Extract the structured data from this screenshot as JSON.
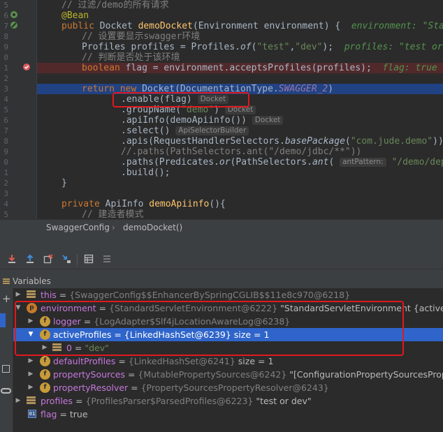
{
  "editor": {
    "line_numbers": [
      "5",
      "6",
      "7",
      "8",
      "9",
      "0",
      "1",
      "2",
      "3",
      "4",
      "5",
      "6",
      "7",
      "8",
      "9",
      "0",
      "1",
      "2",
      "3",
      "4",
      "5"
    ],
    "lines": {
      "l1_comment": "// 过滤/demo的所有请求",
      "l2_annotation": "@Bean",
      "l3_kw1": "public",
      "l3_type": " Docket ",
      "l3_method": "demoDocket",
      "l3_rest": "(Environment environment) {  ",
      "l3_inlay": "environment: \"StandardServ",
      "l4_comment": "// 设置要显示swagger环境",
      "l5_pre": "Profiles profiles = Profiles.",
      "l5_of": "of",
      "l5_args_open": "(",
      "l5_str1": "\"test\"",
      "l5_comma": ",",
      "l5_str2": "\"dev\"",
      "l5_close": ");  ",
      "l5_inlay": "profiles: \"test or dev\"",
      "l6_comment": "// 判断是否处于该环境",
      "l7_kw": "boolean",
      "l7_rest": " flag = environment.acceptsProfiles(profiles);  ",
      "l7_inlay": "flag: true  environ",
      "l9_kw1": "return",
      "l9_kw2": " new",
      "l9_rest": " Docket(DocumentationType.",
      "l9_const": "SWAGGER_2",
      "l9_close": ")",
      "l10_code": ".enable(flag)",
      "l10_hint": "Docket",
      "l11_code": ".groupName(",
      "l11_str": "\"demo\"",
      "l11_close": ")",
      "l11_hint": "Docket",
      "l12_code": ".apiInfo(demoApiinfo())",
      "l12_hint": "Docket",
      "l13_code": ".select()",
      "l13_hint": "ApiSelectorBuilder",
      "l14_code": ".apis(RequestHandlerSelectors.",
      "l14_method": "basePackage",
      "l14_open": "(",
      "l14_str": "\"com.jude.demo\"",
      "l14_close": "))",
      "l14_comment": "//",
      "l15_comment": "//.paths(PathSelectors.ant(\"/demo/jdbc/**\"))",
      "l16_code": ".paths(Predicates.",
      "l16_or": "or",
      "l16_mid": "(PathSelectors.",
      "l16_ant": "ant",
      "l16_open": "( ",
      "l16_hint": "antPattern:",
      "l16_str": " \"/demo/dept/**\"",
      "l16_close": "),",
      "l17_code": ".build();",
      "l18_code": "}",
      "l20_kw": "private",
      "l20_type": " ApiInfo ",
      "l20_method": "demoApiinfo",
      "l20_rest": "(){",
      "l21_comment": "// 建造者模式"
    }
  },
  "breadcrumb": {
    "items": [
      "SwaggerConfig",
      "demoDocket()"
    ],
    "separator": "›"
  },
  "debug": {
    "variables_title": "Variables",
    "toolbar_icons": [
      "step-into-icon",
      "step-out-icon",
      "drop-frame-icon",
      "run-to-cursor-icon",
      "evaluate-expression-icon",
      "trace-icon"
    ],
    "variables": [
      {
        "name": "this",
        "eq": " = ",
        "value": "{SwaggerConfig$$EnhancerBySpringCGLIB$$11e8c970@6218}",
        "extra": ""
      },
      {
        "name": "environment",
        "eq": " = ",
        "value": "{StandardServletEnvironment@6222}",
        "extra": " \"StandardServletEnvironment {activeProf"
      },
      {
        "name": "logger",
        "eq": " = ",
        "value": "{LogAdapter$Slf4jLocationAwareLog@6238}",
        "extra": ""
      },
      {
        "name": "activeProfiles",
        "eq": " = ",
        "value": "{LinkedHashSet@6239}",
        "extra": "  size = 1"
      },
      {
        "name": "0",
        "eq": " = ",
        "value": "\"dev\"",
        "extra": ""
      },
      {
        "name": "defaultProfiles",
        "eq": " = ",
        "value": "{LinkedHashSet@6241}",
        "extra": "  size = 1"
      },
      {
        "name": "propertySources",
        "eq": " = ",
        "value": "{MutablePropertySources@6242}",
        "extra": " \"[ConfigurationPropertySourcesProp"
      },
      {
        "name": "propertyResolver",
        "eq": " = ",
        "value": "{PropertySourcesPropertyResolver@6243}",
        "extra": ""
      },
      {
        "name": "profiles",
        "eq": " = ",
        "value": "{ProfilesParser$ParsedProfiles@6223}",
        "extra": " \"test or dev\""
      },
      {
        "name": "flag",
        "eq": " = ",
        "value": "true",
        "extra": ""
      }
    ]
  },
  "colors": {
    "editor_bg": "#2b2b2b",
    "execution_line": "#214283",
    "breakpoint_line": "#52292b",
    "selection": "#2f65ca",
    "annotation_box": "#e0191d"
  }
}
